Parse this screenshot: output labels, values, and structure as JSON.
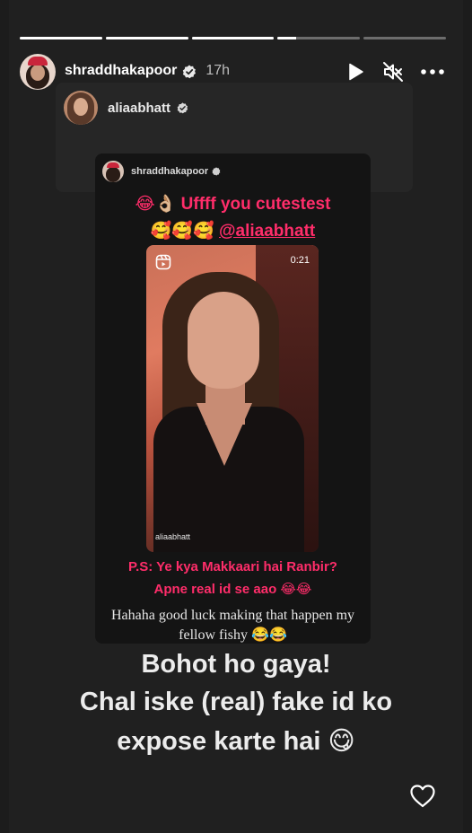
{
  "progress": [
    1.0,
    1.0,
    1.0,
    0.22,
    0.0
  ],
  "header": {
    "username": "shraddhakapoor",
    "time": "17h",
    "avatar_icon": "profile-avatar",
    "verified_icon": "verified-badge-icon",
    "play_icon": "play-icon",
    "mute_icon": "muted-speaker-icon",
    "more_icon": "more-options-icon"
  },
  "repost": {
    "username": "aliaabhatt"
  },
  "inner_post": {
    "username": "shraddhakapoor",
    "caption_line1": "😂👌🏼 Uffff you cutestest",
    "caption_line2_emoji": "🥰🥰🥰 ",
    "caption_line2_mention": "@aliaabhatt",
    "reel_duration": "0:21",
    "reel_username": "aliaabhatt",
    "ps_line1": "P.S: Ye kya Makkaari hai Ranbir?",
    "ps_line2": "Apne real id se aao 😂😂",
    "serif_line1": "Hahaha good luck making that happen my",
    "serif_line2": "fellow fishy 😂😂"
  },
  "overlay": {
    "line1": "Bohot ho gaya!",
    "line2": "Chal iske (real) fake id ko",
    "line3": "expose karte hai 😋"
  },
  "footer": {
    "like_icon": "heart-icon"
  },
  "colors": {
    "accent_pink": "#ff2d6a",
    "background": "#202020"
  }
}
